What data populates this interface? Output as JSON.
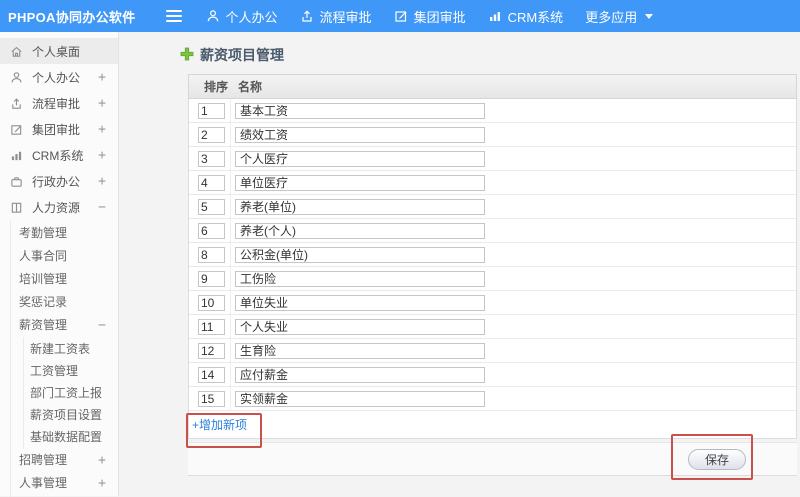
{
  "colors": {
    "topbar_bg": "#3f97f7",
    "link_blue": "#2b7fd9",
    "annotation_red": "#c9504b",
    "plus_green": "#7fc241",
    "title_text": "#4a5a6b"
  },
  "topbar": {
    "logo": "PHPOA协同办公软件",
    "nav": [
      {
        "label": "个人办公",
        "icon": "user-icon"
      },
      {
        "label": "流程审批",
        "icon": "flow-approval-icon"
      },
      {
        "label": "集团审批",
        "icon": "edit-square-icon"
      },
      {
        "label": "CRM系统",
        "icon": "bar-chart-icon"
      },
      {
        "label": "更多应用",
        "icon": "caret-down-icon"
      }
    ]
  },
  "sidebar": {
    "top_items": [
      {
        "label": "个人桌面",
        "icon": "home-icon",
        "expander": ""
      },
      {
        "label": "个人办公",
        "icon": "user-icon",
        "expander": "+"
      },
      {
        "label": "流程审批",
        "icon": "flow-approval-icon",
        "expander": "+"
      },
      {
        "label": "集团审批",
        "icon": "edit-square-icon",
        "expander": "+"
      },
      {
        "label": "CRM系统",
        "icon": "bar-chart-icon",
        "expander": "+"
      },
      {
        "label": "行政办公",
        "icon": "briefcase-icon",
        "expander": "+"
      },
      {
        "label": "人力资源",
        "icon": "book-icon",
        "expander": "−"
      }
    ],
    "hr_children": [
      "考勤管理",
      "人事合同",
      "培训管理",
      "奖惩记录"
    ],
    "salary_group": {
      "label": "薪资管理",
      "expander": "−"
    },
    "salary_children": [
      "新建工资表",
      "工资管理",
      "部门工资上报",
      "薪资项目设置",
      "基础数据配置"
    ],
    "bottom_items": [
      {
        "label": "招聘管理",
        "expander": "+"
      },
      {
        "label": "人事管理",
        "expander": "+"
      }
    ]
  },
  "main": {
    "title": "薪资项目管理",
    "table": {
      "headers": {
        "order": "排序",
        "name": "名称"
      },
      "rows": [
        {
          "order": "1",
          "name": "基本工资"
        },
        {
          "order": "2",
          "name": "绩效工资"
        },
        {
          "order": "3",
          "name": "个人医疗"
        },
        {
          "order": "4",
          "name": "单位医疗"
        },
        {
          "order": "5",
          "name": "养老(单位)"
        },
        {
          "order": "6",
          "name": "养老(个人)"
        },
        {
          "order": "8",
          "name": "公积金(单位)"
        },
        {
          "order": "9",
          "name": "工伤险"
        },
        {
          "order": "10",
          "name": "单位失业"
        },
        {
          "order": "11",
          "name": "个人失业"
        },
        {
          "order": "12",
          "name": "生育险"
        },
        {
          "order": "14",
          "name": "应付薪金"
        },
        {
          "order": "15",
          "name": "实领薪金"
        }
      ]
    },
    "add_link": "+增加新项",
    "save_label": "保存"
  }
}
